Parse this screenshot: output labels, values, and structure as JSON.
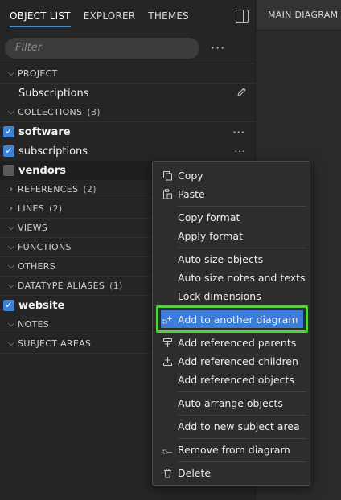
{
  "tabs": [
    "OBJECT LIST",
    "EXPLORER",
    "THEMES"
  ],
  "right_tab": "MAIN DIAGRAM",
  "filter": {
    "placeholder": "Filter",
    "more": "···"
  },
  "sections": {
    "project": "PROJECT",
    "project_item": "Subscriptions",
    "collections": "COLLECTIONS",
    "collections_count": "(3)",
    "collection_items": [
      "software",
      "subscriptions",
      "vendors"
    ],
    "references": "REFERENCES",
    "references_count": "(2)",
    "lines": "LINES",
    "lines_count": "(2)",
    "views": "VIEWS",
    "functions": "FUNCTIONS",
    "others": "OTHERS",
    "datatype_aliases": "DATATYPE ALIASES",
    "datatype_aliases_count": "(1)",
    "alias_item": "website",
    "notes": "NOTES",
    "subject_areas": "SUBJECT AREAS"
  },
  "row_more": "···",
  "context_menu": {
    "copy": "Copy",
    "paste": "Paste",
    "copy_format": "Copy format",
    "apply_format": "Apply format",
    "auto_size_objects": "Auto size objects",
    "auto_size_notes": "Auto size notes and texts",
    "lock_dimensions": "Lock dimensions",
    "add_to_another_diagram": "Add to another diagram",
    "add_referenced_parents": "Add referenced parents",
    "add_referenced_children": "Add referenced children",
    "add_referenced_objects": "Add referenced objects",
    "auto_arrange_objects": "Auto arrange objects",
    "add_to_new_subject_area": "Add to new subject area",
    "remove_from_diagram": "Remove from diagram",
    "delete": "Delete"
  },
  "colors": {
    "accent": "#3b82d9",
    "highlight_border": "#57d13b",
    "menu_bg": "#2d2d2d",
    "panel_bg": "#252526"
  }
}
